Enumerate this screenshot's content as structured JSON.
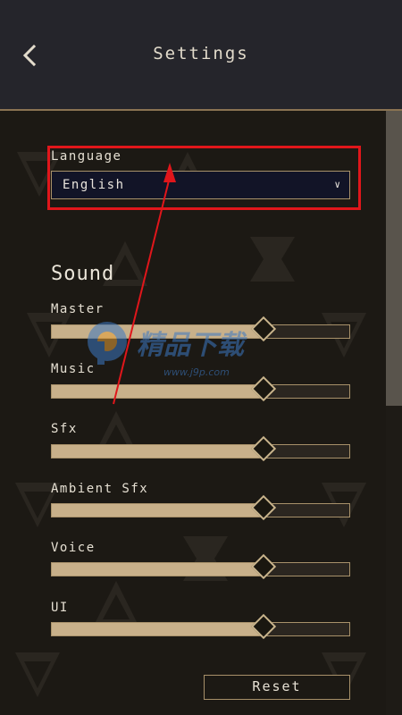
{
  "header": {
    "title": "Settings",
    "back_icon": "chevron-left-icon"
  },
  "language": {
    "label": "Language",
    "selected": "English",
    "dropdown_icon": "chevron-down-icon"
  },
  "sound": {
    "title": "Sound",
    "sliders": [
      {
        "label": "Master",
        "value": 0.71
      },
      {
        "label": "Music",
        "value": 0.71
      },
      {
        "label": "Sfx",
        "value": 0.71
      },
      {
        "label": "Ambient Sfx",
        "value": 0.71
      },
      {
        "label": "Voice",
        "value": 0.71
      },
      {
        "label": "UI",
        "value": 0.71
      }
    ]
  },
  "reset_label": "Reset",
  "watermark": {
    "url": "www.j9p.com"
  },
  "colors": {
    "annotation": "#e0161b",
    "accent": "#c8b08a",
    "header_bg": "#25252b",
    "background": "#1c1914"
  }
}
